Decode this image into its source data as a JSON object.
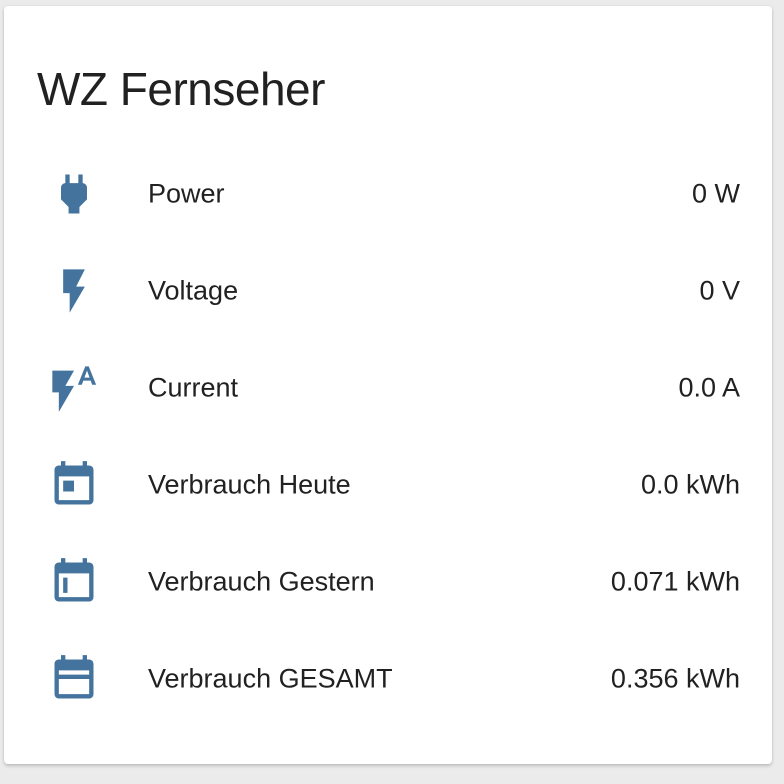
{
  "card": {
    "title": "WZ Fernseher"
  },
  "icon_color": "#44739e",
  "entities": [
    {
      "name": "Power",
      "state": "0 W",
      "icon": "power-plug-icon"
    },
    {
      "name": "Voltage",
      "state": "0 V",
      "icon": "flash-icon"
    },
    {
      "name": "Current",
      "state": "0.0 A",
      "icon": "current-ac-flash-icon"
    },
    {
      "name": "Verbrauch Heute",
      "state": "0.0 kWh",
      "icon": "calendar-today-icon"
    },
    {
      "name": "Verbrauch Gestern",
      "state": "0.071 kWh",
      "icon": "calendar-yesterday-icon"
    },
    {
      "name": "Verbrauch GESAMT",
      "state": "0.356 kWh",
      "icon": "calendar-range-icon"
    }
  ]
}
